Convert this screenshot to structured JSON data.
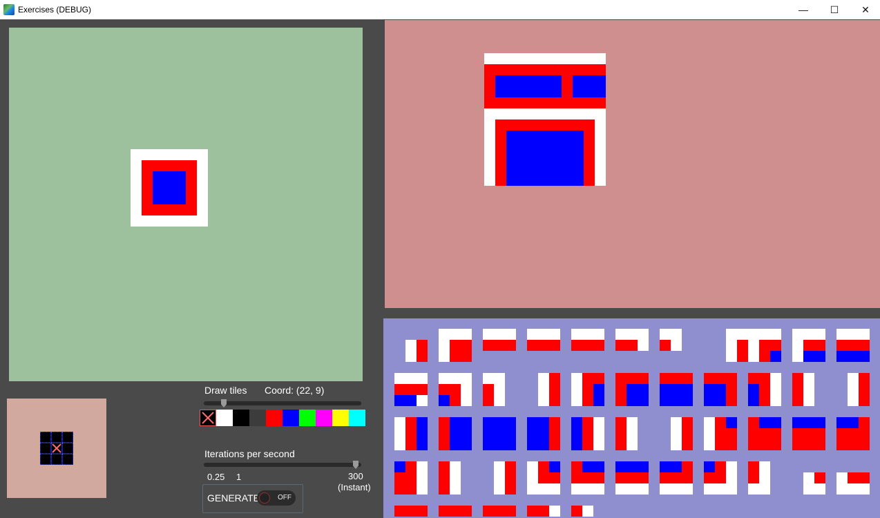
{
  "window": {
    "title": "Exercises (DEBUG)",
    "minimize": "—",
    "maximize": "☐",
    "close": "✕"
  },
  "colors": {
    "input_bg": "#9ec19d",
    "output_bg": "#cf8f8f",
    "tiles_bg": "#8f8fcf",
    "preview_bg": "#d1a99f",
    "red": "#ff0000",
    "blue": "#0000ff",
    "white": "#ffffff"
  },
  "controls": {
    "draw_tiles_label": "Draw tiles",
    "coord_label": "Coord: (22, 9)",
    "palette": [
      "erase",
      "#ffffff",
      "#000000",
      "#3c3c3c",
      "#ff0000",
      "#0000ff",
      "#00ff00",
      "#ff00ff",
      "#ffff00",
      "#00ffff"
    ],
    "palette_names": [
      "eraser-swatch",
      "white-swatch",
      "black-swatch",
      "gray-swatch",
      "red-swatch",
      "blue-swatch",
      "green-swatch",
      "magenta-swatch",
      "yellow-swatch",
      "cyan-swatch"
    ],
    "iterations_label": "Iterations per second",
    "tick_min": "0.25",
    "tick_one": "1",
    "tick_max": "300",
    "tick_max_sub": "(Instant)",
    "generate_label": "GENERATE",
    "toggle_text": "OFF"
  }
}
